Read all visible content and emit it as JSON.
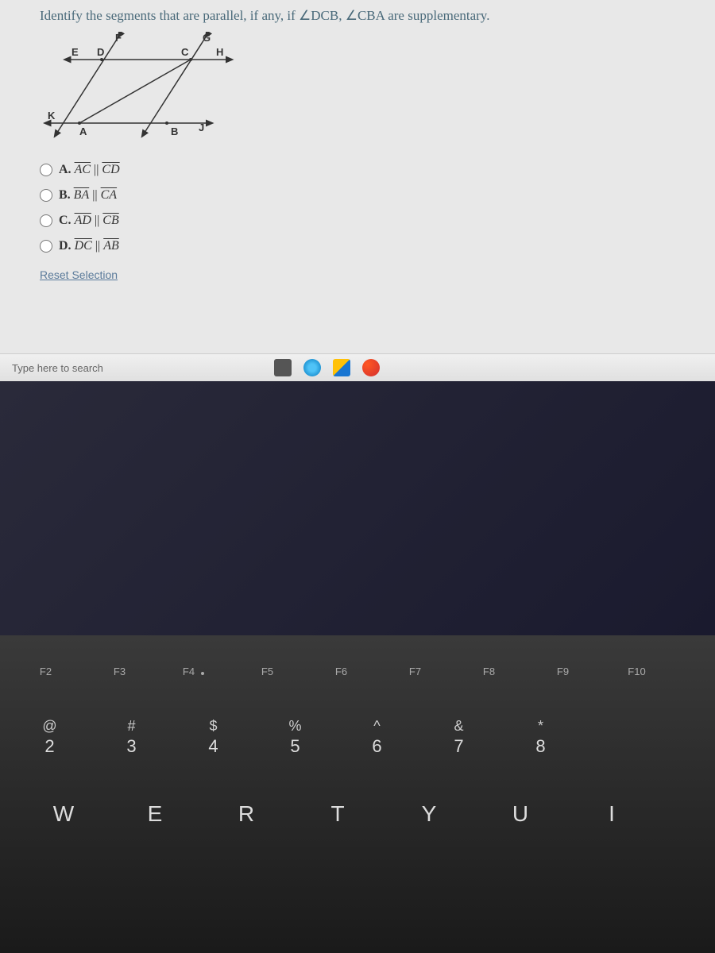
{
  "question": "Identify the segments that are parallel, if any, if ∠DCB, ∠CBA are supplementary.",
  "diagram": {
    "points": [
      "E",
      "D",
      "F",
      "C",
      "G",
      "H",
      "K",
      "A",
      "B",
      "J"
    ]
  },
  "options": [
    {
      "letter": "A.",
      "seg1": "AC",
      "seg2": "CD"
    },
    {
      "letter": "B.",
      "seg1": "BA",
      "seg2": "CA"
    },
    {
      "letter": "C.",
      "seg1": "AD",
      "seg2": "CB"
    },
    {
      "letter": "D.",
      "seg1": "DC",
      "seg2": "AB"
    }
  ],
  "reset_label": "Reset Selection",
  "taskbar": {
    "search_placeholder": "Type here to search"
  },
  "keyboard": {
    "fn_keys": [
      "F2",
      "F3",
      "F4",
      "F5",
      "F6",
      "F7",
      "F8",
      "F9",
      "F10"
    ],
    "num_row": [
      {
        "top": "@",
        "bottom": "2"
      },
      {
        "top": "#",
        "bottom": "3"
      },
      {
        "top": "$",
        "bottom": "4"
      },
      {
        "top": "%",
        "bottom": "5"
      },
      {
        "top": "^",
        "bottom": "6"
      },
      {
        "top": "&",
        "bottom": "7"
      },
      {
        "top": "*",
        "bottom": "8"
      }
    ],
    "letter_row": [
      "W",
      "E",
      "R",
      "T",
      "Y",
      "U",
      "I"
    ]
  }
}
